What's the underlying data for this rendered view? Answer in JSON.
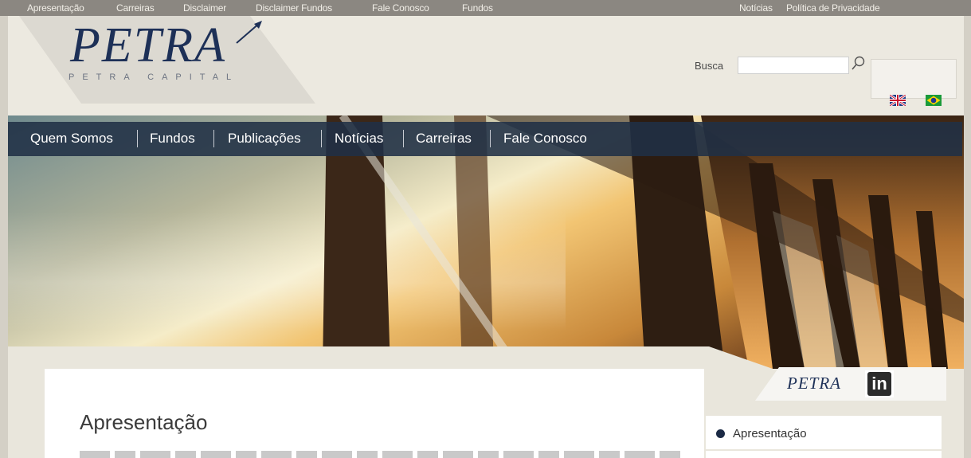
{
  "topbar": {
    "links": [
      "Apresentação",
      "Carreiras",
      "Disclaimer",
      "Disclaimer Fundos",
      "Fale Conosco",
      "Fundos"
    ],
    "right_links": [
      "Notícias",
      "Política de Privacidade"
    ]
  },
  "header": {
    "logo_text": "PETRA",
    "logo_sub": "PETRA CAPITAL",
    "search_label": "Busca",
    "search_value": "",
    "languages": [
      "english-flag",
      "brazil-flag"
    ]
  },
  "nav": {
    "items": [
      "Quem Somos",
      "Fundos",
      "Publicações",
      "Notícias",
      "Carreiras",
      "Fale Conosco"
    ]
  },
  "main": {
    "title": "Apresentação"
  },
  "sidebar": {
    "social_logo": "PETRA",
    "linkedin_label": "in",
    "items": [
      "Apresentação"
    ]
  },
  "colors": {
    "brand_navy": "#1d3057",
    "nav_bg": "#203046",
    "topbar_bg": "#8b8781",
    "page_bg": "#e9e6dc"
  }
}
